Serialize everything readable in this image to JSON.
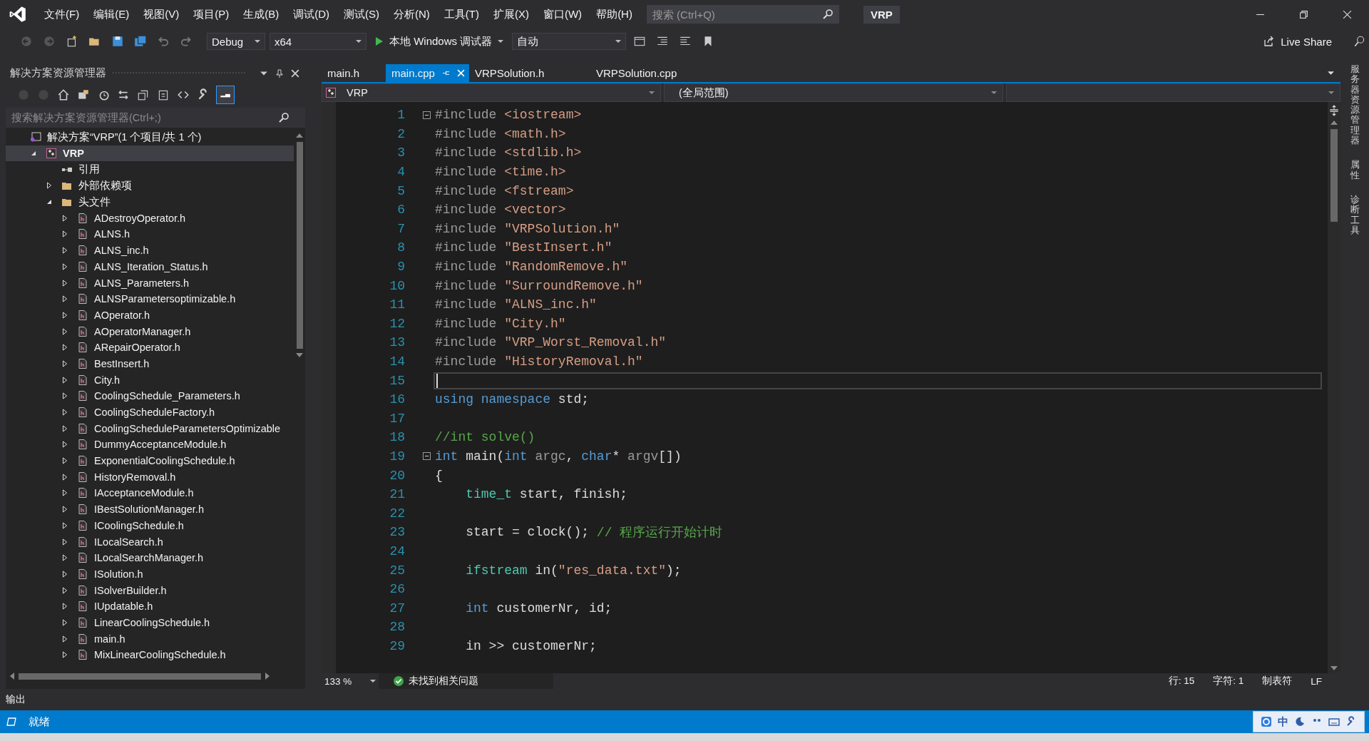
{
  "menu_bar": {
    "items": [
      "文件(F)",
      "编辑(E)",
      "视图(V)",
      "项目(P)",
      "生成(B)",
      "调试(D)",
      "测试(S)",
      "分析(N)",
      "工具(T)",
      "扩展(X)",
      "窗口(W)",
      "帮助(H)"
    ],
    "search": {
      "placeholder": "搜索 (Ctrl+Q)"
    },
    "solution_name": "VRP"
  },
  "toolbar": {
    "configuration": "Debug",
    "platform": "x64",
    "run_target": "本地 Windows 调试器",
    "run_mode": "自动",
    "live_share": "Live Share"
  },
  "explorer": {
    "title": "解决方案资源管理器",
    "search": {
      "placeholder": "搜索解决方案资源管理器(Ctrl+;)"
    },
    "tree": [
      {
        "label": "解决方案“VRP”(1 个项目/共 1 个)",
        "kind": "solution",
        "selected": false,
        "children": [
          {
            "label": "VRP",
            "kind": "project",
            "selected": true,
            "expanded": true,
            "children": [
              {
                "label": "引用",
                "kind": "references",
                "selected": false
              },
              {
                "label": "外部依赖项",
                "kind": "external",
                "selected": false,
                "expanded": false
              },
              {
                "label": "头文件",
                "kind": "folder",
                "selected": false,
                "expanded": true,
                "children": [
                  {
                    "label": "ADestroyOperator.h",
                    "kind": "header",
                    "selected": false,
                    "expanded": false
                  },
                  {
                    "label": "ALNS.h",
                    "kind": "header",
                    "selected": false,
                    "expanded": false
                  },
                  {
                    "label": "ALNS_inc.h",
                    "kind": "header",
                    "selected": false,
                    "expanded": false
                  },
                  {
                    "label": "ALNS_Iteration_Status.h",
                    "kind": "header",
                    "selected": false,
                    "expanded": false
                  },
                  {
                    "label": "ALNS_Parameters.h",
                    "kind": "header",
                    "selected": false,
                    "expanded": false
                  },
                  {
                    "label": "ALNSParametersoptimizable.h",
                    "kind": "header",
                    "selected": false,
                    "expanded": false
                  },
                  {
                    "label": "AOperator.h",
                    "kind": "header",
                    "selected": false,
                    "expanded": false
                  },
                  {
                    "label": "AOperatorManager.h",
                    "kind": "header",
                    "selected": false,
                    "expanded": false
                  },
                  {
                    "label": "ARepairOperator.h",
                    "kind": "header",
                    "selected": false,
                    "expanded": false
                  },
                  {
                    "label": "BestInsert.h",
                    "kind": "header",
                    "selected": false,
                    "expanded": false
                  },
                  {
                    "label": "City.h",
                    "kind": "header",
                    "selected": false,
                    "expanded": false
                  },
                  {
                    "label": "CoolingSchedule_Parameters.h",
                    "kind": "header",
                    "selected": false,
                    "expanded": false
                  },
                  {
                    "label": "CoolingScheduleFactory.h",
                    "kind": "header",
                    "selected": false,
                    "expanded": false
                  },
                  {
                    "label": "CoolingScheduleParametersOptimizable",
                    "kind": "header",
                    "selected": false,
                    "expanded": false
                  },
                  {
                    "label": "DummyAcceptanceModule.h",
                    "kind": "header",
                    "selected": false,
                    "expanded": false
                  },
                  {
                    "label": "ExponentialCoolingSchedule.h",
                    "kind": "header",
                    "selected": false,
                    "expanded": false
                  },
                  {
                    "label": "HistoryRemoval.h",
                    "kind": "header",
                    "selected": false,
                    "expanded": false
                  },
                  {
                    "label": "IAcceptanceModule.h",
                    "kind": "header",
                    "selected": false,
                    "expanded": false
                  },
                  {
                    "label": "IBestSolutionManager.h",
                    "kind": "header",
                    "selected": false,
                    "expanded": false
                  },
                  {
                    "label": "ICoolingSchedule.h",
                    "kind": "header",
                    "selected": false,
                    "expanded": false
                  },
                  {
                    "label": "ILocalSearch.h",
                    "kind": "header",
                    "selected": false,
                    "expanded": false
                  },
                  {
                    "label": "ILocalSearchManager.h",
                    "kind": "header",
                    "selected": false,
                    "expanded": false
                  },
                  {
                    "label": "ISolution.h",
                    "kind": "header",
                    "selected": false,
                    "expanded": false
                  },
                  {
                    "label": "ISolverBuilder.h",
                    "kind": "header",
                    "selected": false,
                    "expanded": false
                  },
                  {
                    "label": "IUpdatable.h",
                    "kind": "header",
                    "selected": false,
                    "expanded": false
                  },
                  {
                    "label": "LinearCoolingSchedule.h",
                    "kind": "header",
                    "selected": false,
                    "expanded": false
                  },
                  {
                    "label": "main.h",
                    "kind": "header",
                    "selected": false,
                    "expanded": false
                  },
                  {
                    "label": "MixLinearCoolingSchedule.h",
                    "kind": "header",
                    "selected": false,
                    "expanded": false
                  }
                ]
              }
            ]
          }
        ]
      }
    ]
  },
  "editor": {
    "tabs": [
      {
        "label": "main.h",
        "selected": false
      },
      {
        "label": "main.cpp",
        "selected": true
      },
      {
        "label": "VRPSolution.h",
        "selected": false
      },
      {
        "label": "VRPSolution.cpp",
        "selected": false
      }
    ],
    "nav": {
      "project": "VRP",
      "scope": "(全局范围)"
    },
    "lines": [
      {
        "number": "1",
        "fold": true,
        "current": false,
        "tokens": [
          {
            "text": "#include ",
            "kind": "directive"
          },
          {
            "text": "<iostream>",
            "kind": "header"
          }
        ]
      },
      {
        "number": "2",
        "fold": false,
        "current": false,
        "tokens": [
          {
            "text": "#include ",
            "kind": "directive"
          },
          {
            "text": "<math.h>",
            "kind": "header"
          }
        ]
      },
      {
        "number": "3",
        "fold": false,
        "current": false,
        "tokens": [
          {
            "text": "#include ",
            "kind": "directive"
          },
          {
            "text": "<stdlib.h>",
            "kind": "header"
          }
        ]
      },
      {
        "number": "4",
        "fold": false,
        "current": false,
        "tokens": [
          {
            "text": "#include ",
            "kind": "directive"
          },
          {
            "text": "<time.h>",
            "kind": "header"
          }
        ]
      },
      {
        "number": "5",
        "fold": false,
        "current": false,
        "tokens": [
          {
            "text": "#include ",
            "kind": "directive"
          },
          {
            "text": "<fstream>",
            "kind": "header"
          }
        ]
      },
      {
        "number": "6",
        "fold": false,
        "current": false,
        "tokens": [
          {
            "text": "#include ",
            "kind": "directive"
          },
          {
            "text": "<vector>",
            "kind": "header"
          }
        ]
      },
      {
        "number": "7",
        "fold": false,
        "current": false,
        "tokens": [
          {
            "text": "#include ",
            "kind": "directive"
          },
          {
            "text": "\"VRPSolution.h\"",
            "kind": "string"
          }
        ]
      },
      {
        "number": "8",
        "fold": false,
        "current": false,
        "tokens": [
          {
            "text": "#include ",
            "kind": "directive"
          },
          {
            "text": "\"BestInsert.h\"",
            "kind": "string"
          }
        ]
      },
      {
        "number": "9",
        "fold": false,
        "current": false,
        "tokens": [
          {
            "text": "#include ",
            "kind": "directive"
          },
          {
            "text": "\"RandomRemove.h\"",
            "kind": "string"
          }
        ]
      },
      {
        "number": "10",
        "fold": false,
        "current": false,
        "tokens": [
          {
            "text": "#include ",
            "kind": "directive"
          },
          {
            "text": "\"SurroundRemove.h\"",
            "kind": "string"
          }
        ]
      },
      {
        "number": "11",
        "fold": false,
        "current": false,
        "tokens": [
          {
            "text": "#include ",
            "kind": "directive"
          },
          {
            "text": "\"ALNS_inc.h\"",
            "kind": "string"
          }
        ]
      },
      {
        "number": "12",
        "fold": false,
        "current": false,
        "tokens": [
          {
            "text": "#include ",
            "kind": "directive"
          },
          {
            "text": "\"City.h\"",
            "kind": "string"
          }
        ]
      },
      {
        "number": "13",
        "fold": false,
        "current": false,
        "tokens": [
          {
            "text": "#include ",
            "kind": "directive"
          },
          {
            "text": "\"VRP_Worst_Removal.h\"",
            "kind": "string"
          }
        ]
      },
      {
        "number": "14",
        "fold": false,
        "current": false,
        "tokens": [
          {
            "text": "#include ",
            "kind": "directive"
          },
          {
            "text": "\"HistoryRemoval.h\"",
            "kind": "string"
          }
        ]
      },
      {
        "number": "15",
        "fold": false,
        "current": true
      },
      {
        "number": "16",
        "fold": false,
        "current": false,
        "tokens": [
          {
            "text": "using namespace",
            "kind": "keyword"
          },
          {
            "text": " std;",
            "kind": "plain"
          }
        ]
      },
      {
        "number": "17",
        "fold": false,
        "current": false
      },
      {
        "number": "18",
        "fold": false,
        "current": false,
        "tokens": [
          {
            "text": "//int solve()",
            "kind": "comment"
          }
        ]
      },
      {
        "number": "19",
        "fold": true,
        "current": false,
        "tokens": [
          {
            "text": "int",
            "kind": "keyword"
          },
          {
            "text": " main(",
            "kind": "plain"
          },
          {
            "text": "int",
            "kind": "keyword"
          },
          {
            "text": " argc",
            "kind": "param"
          },
          {
            "text": ", ",
            "kind": "plain"
          },
          {
            "text": "char",
            "kind": "keyword"
          },
          {
            "text": "* ",
            "kind": "plain"
          },
          {
            "text": "argv",
            "kind": "param"
          },
          {
            "text": "[])",
            "kind": "plain"
          }
        ]
      },
      {
        "number": "20",
        "fold": false,
        "current": false,
        "tokens": [
          {
            "text": "{",
            "kind": "plain"
          }
        ],
        "children": [
          {
            "number": "21",
            "fold": false,
            "current": false,
            "tokens": [
              {
                "text": "time_t",
                "kind": "type"
              },
              {
                "text": " start, finish;",
                "kind": "plain"
              }
            ]
          },
          {
            "number": "22",
            "fold": false,
            "current": false
          },
          {
            "number": "23",
            "fold": false,
            "current": false,
            "tokens": [
              {
                "text": "start = clock(); ",
                "kind": "plain"
              },
              {
                "text": "// 程序运行开始计时",
                "kind": "comment"
              }
            ]
          },
          {
            "number": "24",
            "fold": false,
            "current": false
          },
          {
            "number": "25",
            "fold": false,
            "current": false,
            "tokens": [
              {
                "text": "ifstream",
                "kind": "type"
              },
              {
                "text": " in(",
                "kind": "plain"
              },
              {
                "text": "\"res_data.txt\"",
                "kind": "string"
              },
              {
                "text": ");",
                "kind": "plain"
              }
            ]
          },
          {
            "number": "26",
            "fold": false,
            "current": false
          },
          {
            "number": "27",
            "fold": false,
            "current": false,
            "tokens": [
              {
                "text": "int",
                "kind": "keyword"
              },
              {
                "text": " customerNr, id;",
                "kind": "plain"
              }
            ]
          },
          {
            "number": "28",
            "fold": false,
            "current": false
          },
          {
            "number": "29",
            "fold": false,
            "current": false,
            "tokens": [
              {
                "text": "in >> customerNr;",
                "kind": "plain"
              }
            ]
          }
        ]
      }
    ],
    "status": {
      "zoom": "133 %",
      "issues": "未找到相关问题",
      "line": "行: 15",
      "column": "字符: 1",
      "indent": "制表符",
      "line_ending": "LF"
    }
  },
  "side_tabs": [
    "服务器资源管理器",
    "属性",
    "诊断工具"
  ],
  "output": {
    "title": "输出"
  },
  "status_bar": {
    "text": "就绪"
  },
  "ime_bar": {
    "mode": "中"
  }
}
